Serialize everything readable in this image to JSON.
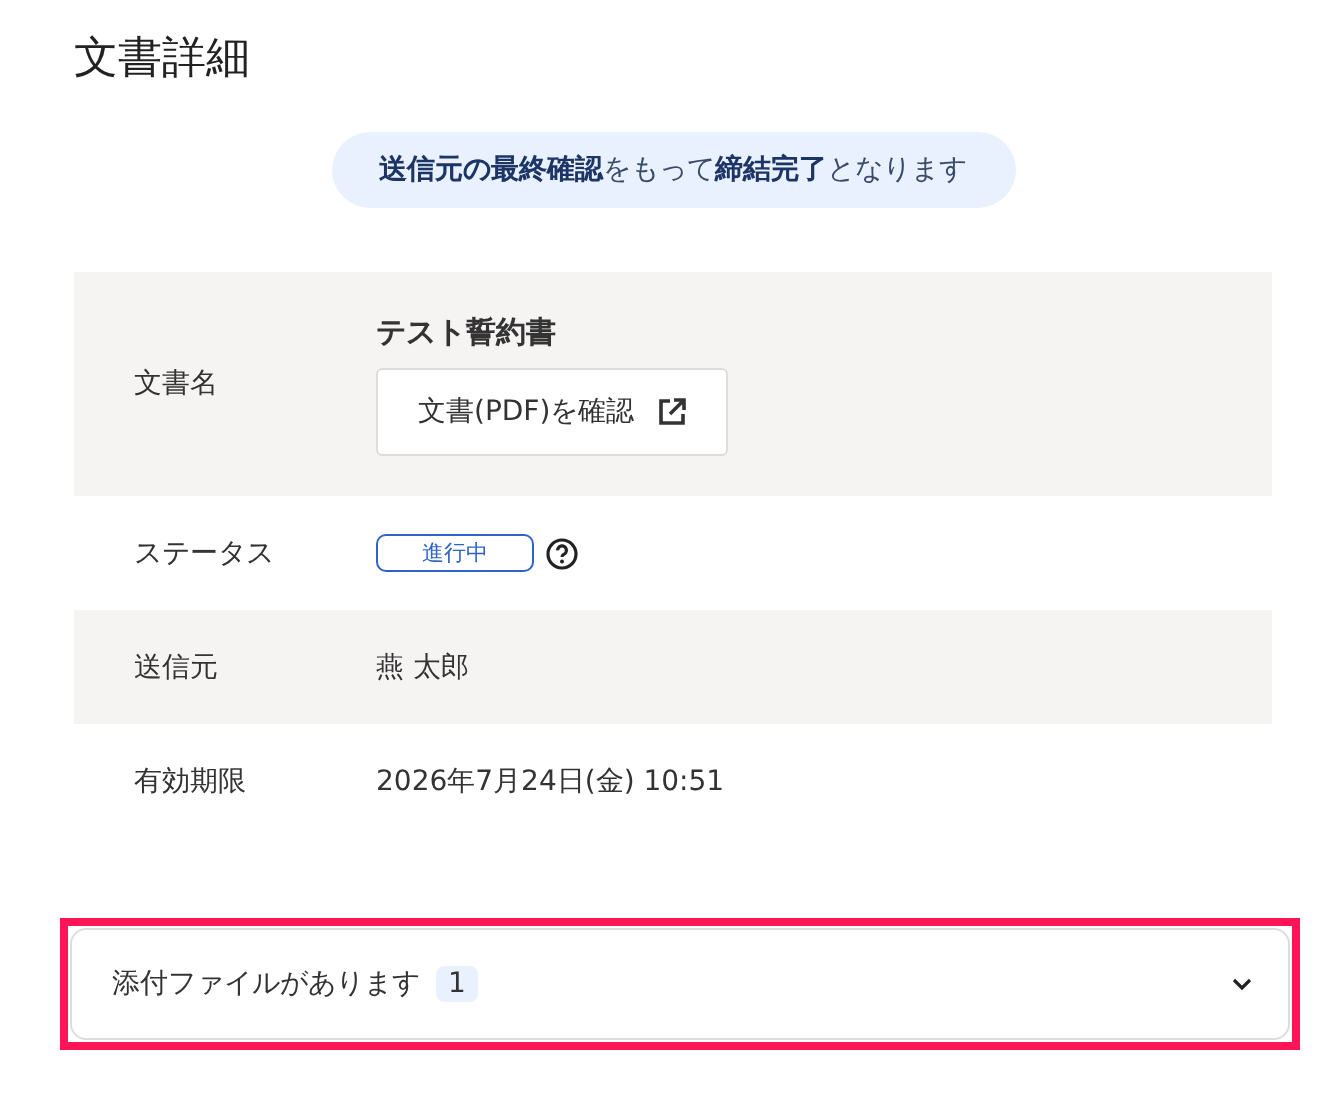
{
  "title": "文書詳細",
  "notice": "**送信元の最終確認**をもって**締結完了**となります",
  "rows": [
    {
      "kind": "document",
      "label": "文書名",
      "name": "テスト誓約書",
      "button": "文書(PDF)を確認"
    },
    {
      "kind": "status",
      "label": "ステータス",
      "badge": "進行中"
    },
    {
      "kind": "text",
      "label": "送信元",
      "value": "燕 太郎"
    },
    {
      "kind": "text",
      "label": "有効期限",
      "value": "2026年7月24日(金) 10:51"
    }
  ],
  "attachments": {
    "label": "添付ファイルがあります",
    "count": "1",
    "expanded": false
  }
}
